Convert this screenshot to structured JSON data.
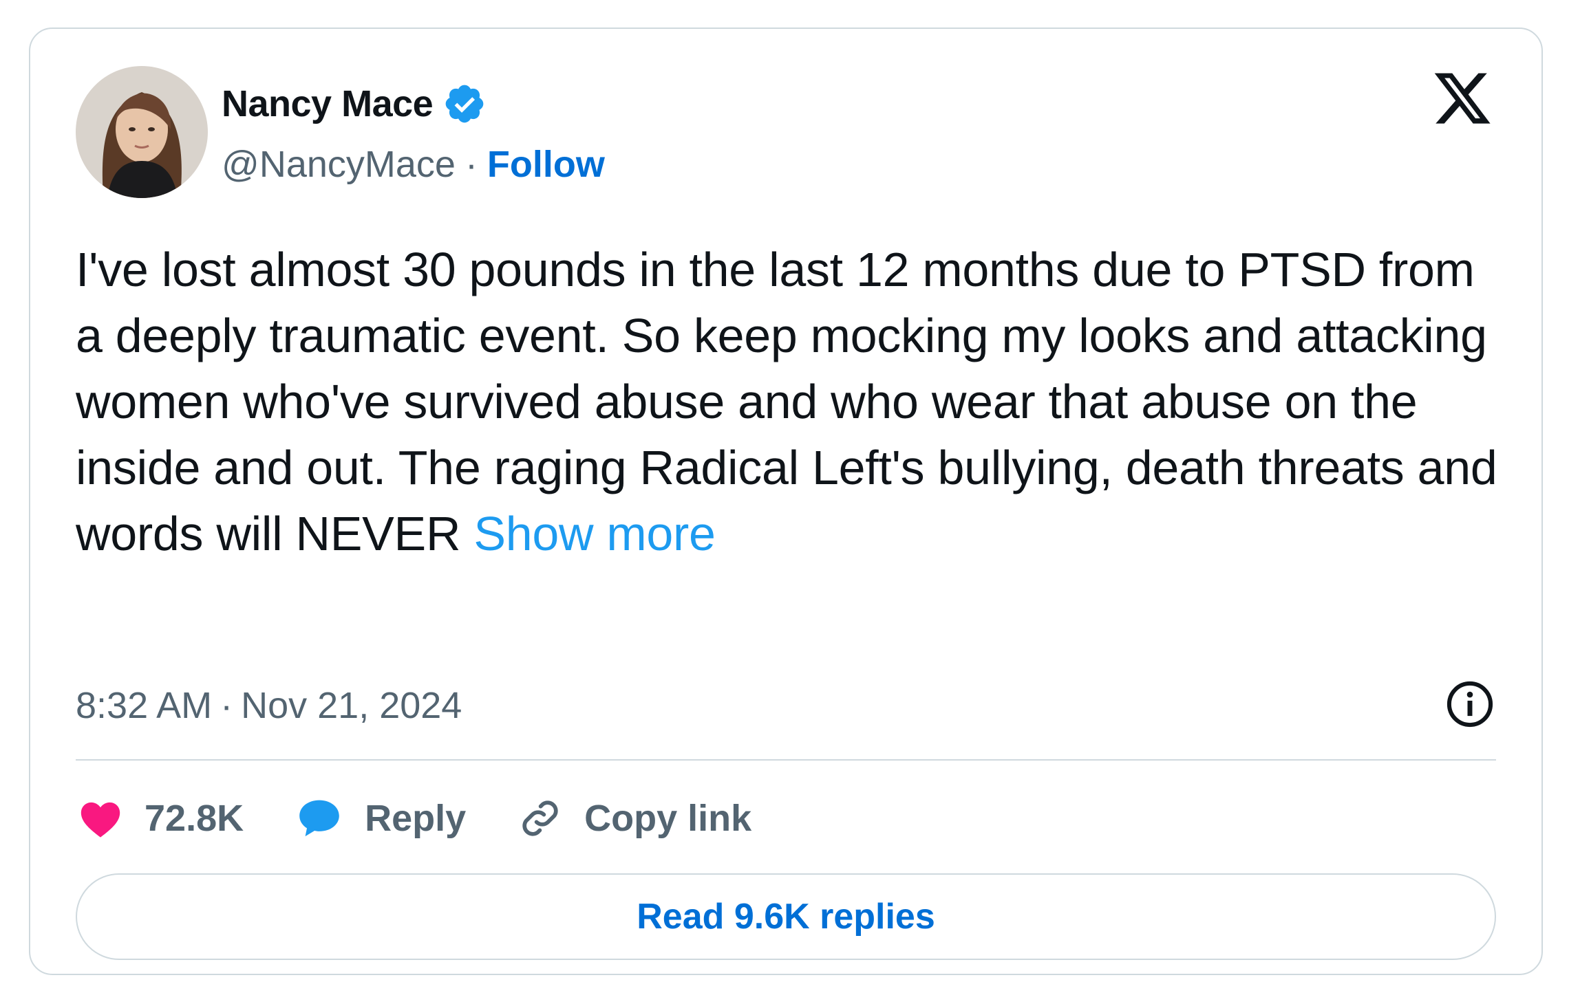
{
  "author": {
    "name": "Nancy Mace",
    "handle": "@NancyMace",
    "separator": "·",
    "follow_label": "Follow"
  },
  "tweet": {
    "text": "I've lost almost 30 pounds in the last 12 months due to PTSD from a deeply traumatic event. So keep mocking my looks and attacking women who've survived abuse and who wear that abuse on the inside and out. The raging Radical Left's bullying,  death threats and words will NEVER ",
    "show_more_label": "Show more",
    "time": "8:32 AM",
    "date_separator": "·",
    "date": "Nov 21, 2024"
  },
  "actions": {
    "likes_count": "72.8K",
    "reply_label": "Reply",
    "copy_link_label": "Copy link"
  },
  "read_replies_label": "Read 9.6K replies",
  "icons": {
    "verified": "verified-badge-icon",
    "x_logo": "x-logo-icon",
    "info": "info-icon",
    "like": "heart-icon",
    "reply": "speech-bubble-icon",
    "copy_link": "link-icon"
  },
  "colors": {
    "accent": "#1d9bf0",
    "follow": "#006fd6",
    "like": "#f91880",
    "muted": "#536471",
    "border": "#cfd9de",
    "text": "#0f1419"
  }
}
